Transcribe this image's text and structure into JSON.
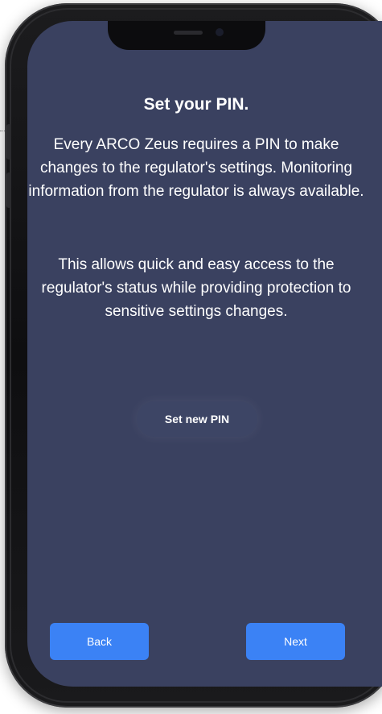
{
  "screen": {
    "title": "Set your PIN.",
    "paragraph_1": "Every ARCO Zeus requires a PIN to make changes to the regulator's settings. Monitoring information from the regulator is always available.",
    "paragraph_2": "This allows quick and easy access to the regulator's status while providing protection to sensitive settings changes.",
    "set_pin_label": "Set new PIN",
    "back_label": "Back",
    "next_label": "Next"
  },
  "colors": {
    "screen_background": "#3a4160",
    "button_blue": "#3b82f5",
    "phone_frame": "#1c1c1e"
  }
}
